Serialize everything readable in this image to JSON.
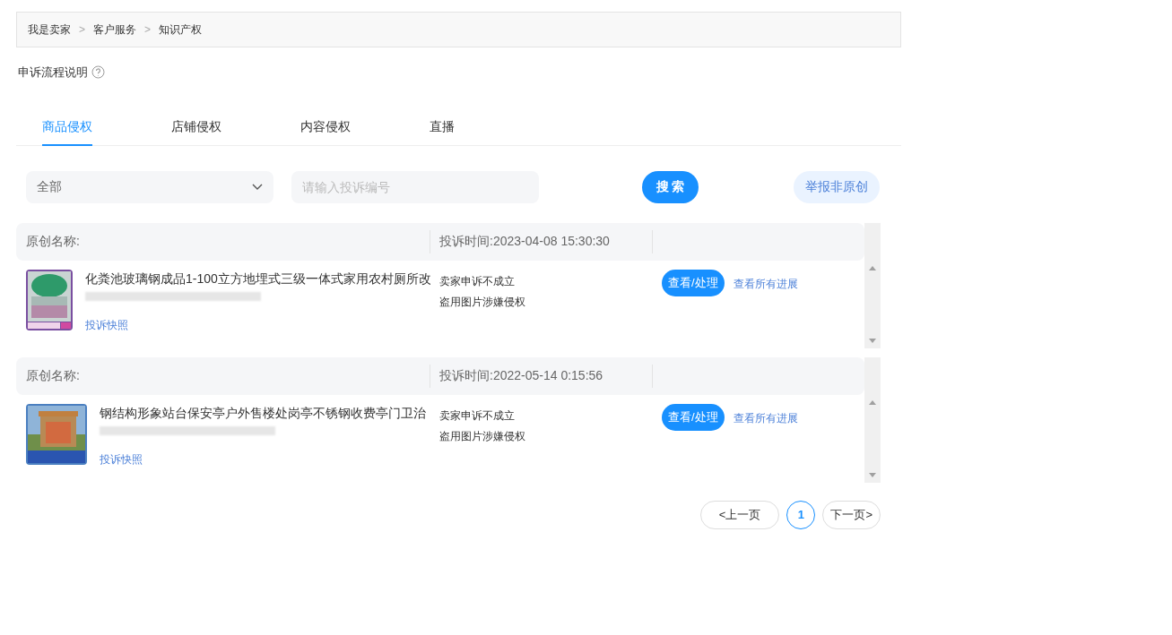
{
  "breadcrumb": [
    "我是卖家",
    "客户服务",
    "知识产权"
  ],
  "breadcrumb_separator": ">",
  "help": {
    "label": "申诉流程说明"
  },
  "tabs": [
    {
      "label": "商品侵权",
      "selected": true
    },
    {
      "label": "店铺侵权",
      "selected": false
    },
    {
      "label": "内容侵权",
      "selected": false
    },
    {
      "label": "直播",
      "selected": false
    }
  ],
  "filter": {
    "value": "全部",
    "placeholder": "请输入投诉编号",
    "search_button": "搜 索",
    "report_button": "举报非原创"
  },
  "complaints": [
    {
      "original_label": "原创名称:",
      "time": "投诉时间:2023-04-08 15:30:30",
      "kind": "picture",
      "title": "化粪池玻璃钢成品1-100立方地埋式三级一体式家用农村厕所改",
      "snapshot_link": "投诉快照",
      "status": "卖家申诉不成立",
      "reason": "盗用图片涉嫌侵权",
      "action_button": "查看/处理",
      "progress_link": "查看所有进展"
    },
    {
      "original_label": "原创名称:",
      "time": "投诉时间:2022-05-14 0:15:56",
      "kind": "picture",
      "title": "钢结构形象站台保安亭户外售楼处岗亭不锈钢收费亭门卫治",
      "snapshot_link": "投诉快照",
      "status": "卖家申诉不成立",
      "reason": "盗用图片涉嫌侵权",
      "action_button": "查看/处理",
      "progress_link": "查看所有进展"
    }
  ],
  "pagination": {
    "prev": "<上一页",
    "pages": [
      {
        "label": "1",
        "selected": true
      }
    ],
    "next": "下一页>"
  }
}
